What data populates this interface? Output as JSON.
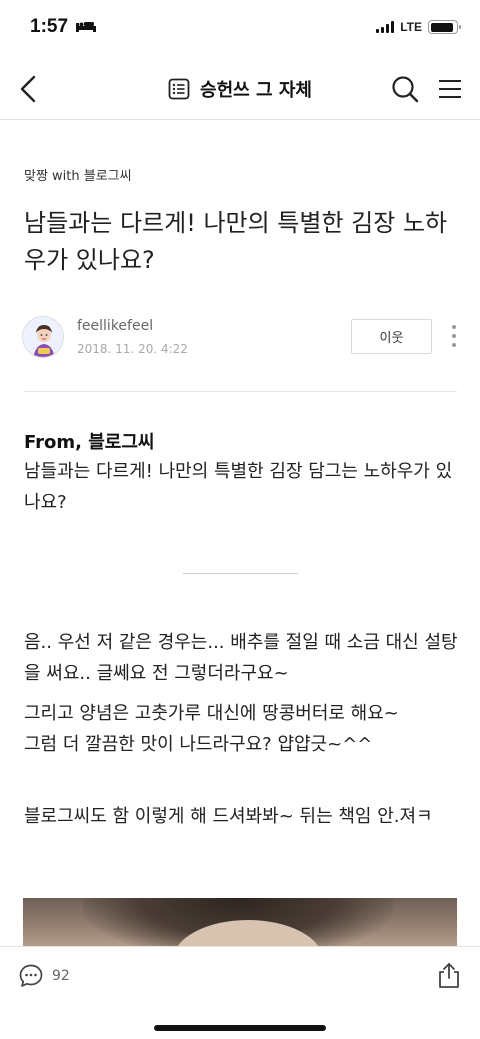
{
  "status_bar": {
    "time": "1:57",
    "network": "LTE",
    "battery_level": 0.9
  },
  "nav": {
    "title": "승헌쓰 그 자체"
  },
  "post": {
    "category": "맞짱 with 블로그씨",
    "title": "남들과는 다르게! 나만의 특별한 김장 노하우가 있나요?",
    "author": "feellikefeel",
    "date": "2018. 11. 20. 4:22",
    "neighbor_label": "이웃",
    "from_title": "From, 블로그씨",
    "from_body": "남들과는 다르게! 나만의 특별한 김장 담그는 노하우가 있나요?",
    "paragraphs": [
      "음.. 우선 저 같은 경우는... 배추를 절일 때 소금 대신 설탕을 써요.. 글쎄요 전 그렇더라구요~",
      "그리고 양념은 고춧가루 대신에 땅콩버터로 해요~",
      "그럼 더 깔끔한 맛이 나드라구요? 얍얍긋~^^",
      "블로그씨도 함 이렇게 해 드셔봐봐~ 뒤는 책임 안.져ㅋ"
    ]
  },
  "bottom_bar": {
    "comment_count": "92"
  }
}
